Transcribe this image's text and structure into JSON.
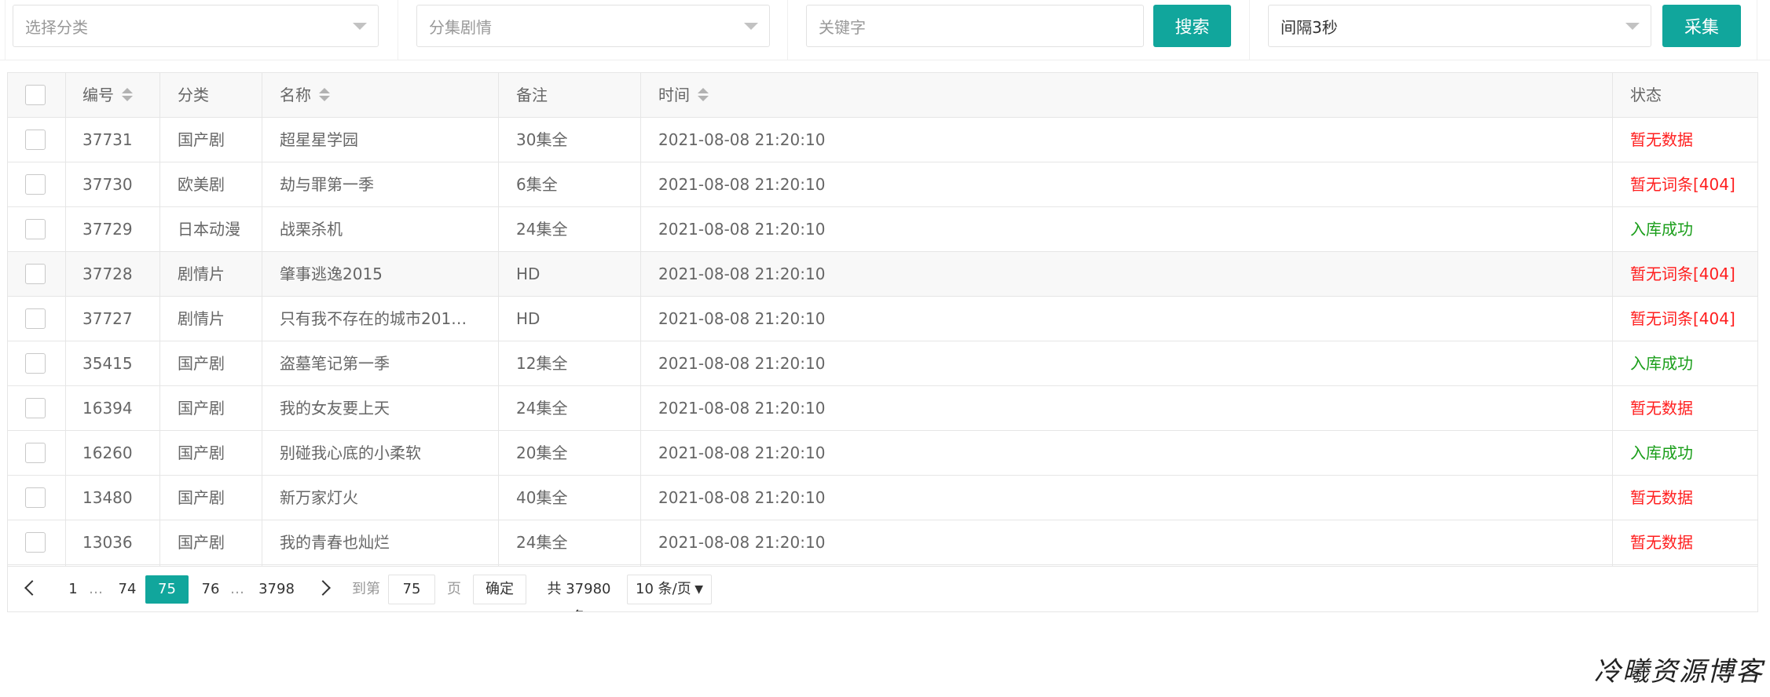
{
  "filters": {
    "category_placeholder": "选择分类",
    "plot_placeholder": "分集剧情",
    "keyword_placeholder": "关键字",
    "search_label": "搜索",
    "interval_value": "间隔3秒",
    "collect_label": "采集"
  },
  "table": {
    "columns": {
      "id": "编号",
      "category": "分类",
      "name": "名称",
      "note": "备注",
      "time": "时间",
      "status": "状态"
    },
    "rows": [
      {
        "id": "37731",
        "category": "国产剧",
        "name": "超星星学园",
        "note": "30集全",
        "time": "2021-08-08 21:20:10",
        "status": "暂无数据",
        "status_type": "red"
      },
      {
        "id": "37730",
        "category": "欧美剧",
        "name": "劫与罪第一季",
        "note": "6集全",
        "time": "2021-08-08 21:20:10",
        "status": "暂无词条[404]",
        "status_type": "red"
      },
      {
        "id": "37729",
        "category": "日本动漫",
        "name": "战栗杀机",
        "note": "24集全",
        "time": "2021-08-08 21:20:10",
        "status": "入库成功",
        "status_type": "green"
      },
      {
        "id": "37728",
        "category": "剧情片",
        "name": "肇事逃逸2015",
        "note": "HD",
        "time": "2021-08-08 21:20:10",
        "status": "暂无词条[404]",
        "status_type": "red"
      },
      {
        "id": "37727",
        "category": "剧情片",
        "name": "只有我不存在的城市201…",
        "note": "HD",
        "time": "2021-08-08 21:20:10",
        "status": "暂无词条[404]",
        "status_type": "red"
      },
      {
        "id": "35415",
        "category": "国产剧",
        "name": "盗墓笔记第一季",
        "note": "12集全",
        "time": "2021-08-08 21:20:10",
        "status": "入库成功",
        "status_type": "green"
      },
      {
        "id": "16394",
        "category": "国产剧",
        "name": "我的女友要上天",
        "note": "24集全",
        "time": "2021-08-08 21:20:10",
        "status": "暂无数据",
        "status_type": "red"
      },
      {
        "id": "16260",
        "category": "国产剧",
        "name": "别碰我心底的小柔软",
        "note": "20集全",
        "time": "2021-08-08 21:20:10",
        "status": "入库成功",
        "status_type": "green"
      },
      {
        "id": "13480",
        "category": "国产剧",
        "name": "新万家灯火",
        "note": "40集全",
        "time": "2021-08-08 21:20:10",
        "status": "暂无数据",
        "status_type": "red"
      },
      {
        "id": "13036",
        "category": "国产剧",
        "name": "我的青春也灿烂",
        "note": "24集全",
        "time": "2021-08-08 21:20:10",
        "status": "暂无数据",
        "status_type": "red"
      }
    ],
    "highlighted_row": 3
  },
  "pagination": {
    "first": "1",
    "ellipsis": "…",
    "prev_page": "74",
    "current": "75",
    "next_page": "76",
    "last": "3798",
    "goto_label": "到第",
    "goto_value": "75",
    "page_unit": "页",
    "confirm_label": "确定",
    "total_text": "共 37980 条",
    "page_size": "10 条/页"
  },
  "watermark": "冷曦资源博客",
  "colors": {
    "accent": "#11a69c",
    "status_red": "#ff1e1e",
    "status_green": "#1a9e1a"
  }
}
